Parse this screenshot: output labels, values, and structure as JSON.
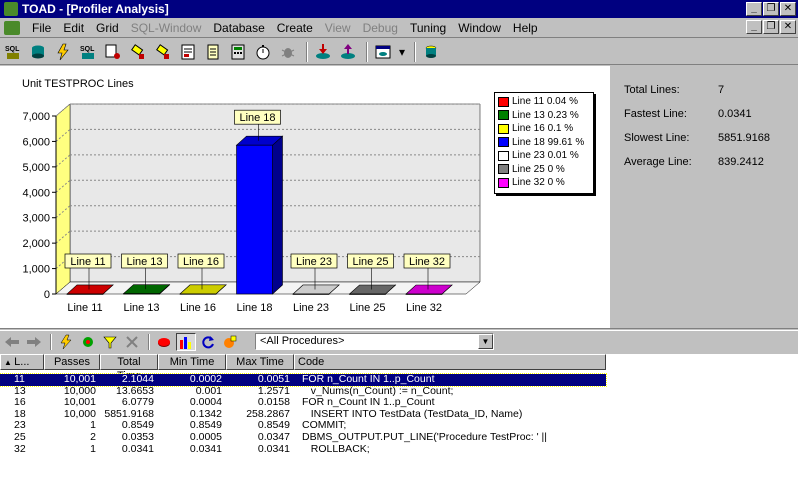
{
  "window": {
    "title": "TOAD - [Profiler Analysis]"
  },
  "menu": [
    "File",
    "Edit",
    "Grid",
    "SQL-Window",
    "Database",
    "Create",
    "View",
    "Debug",
    "Tuning",
    "Window",
    "Help"
  ],
  "menu_disabled": [
    "SQL-Window",
    "View",
    "Debug"
  ],
  "toolbar": {
    "icons": [
      "sql-icon",
      "schema-icon",
      "sql-lightning-icon",
      "sql-icon",
      "tools-icon",
      "flashlight-icon",
      "flashlight-icon",
      "report-icon",
      "notepad-icon",
      "calculator-icon",
      "stopwatch-icon",
      "debug-icon",
      "import-icon",
      "export-icon",
      "window-icon",
      "dropdown-icon",
      "database-icon"
    ]
  },
  "stats": {
    "total_lines_label": "Total Lines:",
    "total_lines": "7",
    "fastest_label": "Fastest Line:",
    "fastest": "0.0341",
    "slowest_label": "Slowest Line:",
    "slowest": "5851.9168",
    "average_label": "Average Line:",
    "average": "839.2412"
  },
  "chart_data": {
    "type": "bar",
    "title": "Unit TESTPROC Lines",
    "categories": [
      "Line 11",
      "Line 13",
      "Line 16",
      "Line 18",
      "Line 23",
      "Line 25",
      "Line 32"
    ],
    "values": [
      2.1044,
      13.6653,
      6.0779,
      5851.9168,
      0.8549,
      0.0353,
      0.0341
    ],
    "colors": [
      "#ff0000",
      "#008000",
      "#ffff00",
      "#0000ff",
      "#ffffff",
      "#808080",
      "#ff00ff"
    ],
    "ylim": [
      0,
      7000
    ],
    "yticks": [
      "0",
      "1,000",
      "2,000",
      "3,000",
      "4,000",
      "5,000",
      "6,000",
      "7,000"
    ],
    "legend": [
      "Line 11 0.04 %",
      "Line 13 0.23 %",
      "Line 16 0.1 %",
      "Line 18 99.61 %",
      "Line 23 0.01 %",
      "Line 25 0 %",
      "Line 32 0 %"
    ],
    "legend_position": "top-right"
  },
  "filter": {
    "value": "<All Procedures>"
  },
  "grid": {
    "headers": [
      "L...",
      "Passes",
      "Total Time",
      "Min Time",
      "Max Time",
      "Code"
    ],
    "rows": [
      [
        "11",
        "10,001",
        "2.1044",
        "0.0002",
        "0.0051",
        "FOR n_Count IN 1..p_Count"
      ],
      [
        "13",
        "10,000",
        "13.6653",
        "0.001",
        "1.2571",
        "   v_Nums(n_Count) := n_Count;"
      ],
      [
        "16",
        "10,001",
        "6.0779",
        "0.0004",
        "0.0158",
        "FOR n_Count IN 1..p_Count"
      ],
      [
        "18",
        "10,000",
        "5851.9168",
        "0.1342",
        "258.2867",
        "   INSERT INTO TestData (TestData_ID, Name)"
      ],
      [
        "23",
        "1",
        "0.8549",
        "0.8549",
        "0.8549",
        "COMMIT;"
      ],
      [
        "25",
        "2",
        "0.0353",
        "0.0005",
        "0.0347",
        "DBMS_OUTPUT.PUT_LINE('Procedure TestProc: ' ||"
      ],
      [
        "32",
        "1",
        "0.0341",
        "0.0341",
        "0.0341",
        "   ROLLBACK;"
      ]
    ]
  }
}
